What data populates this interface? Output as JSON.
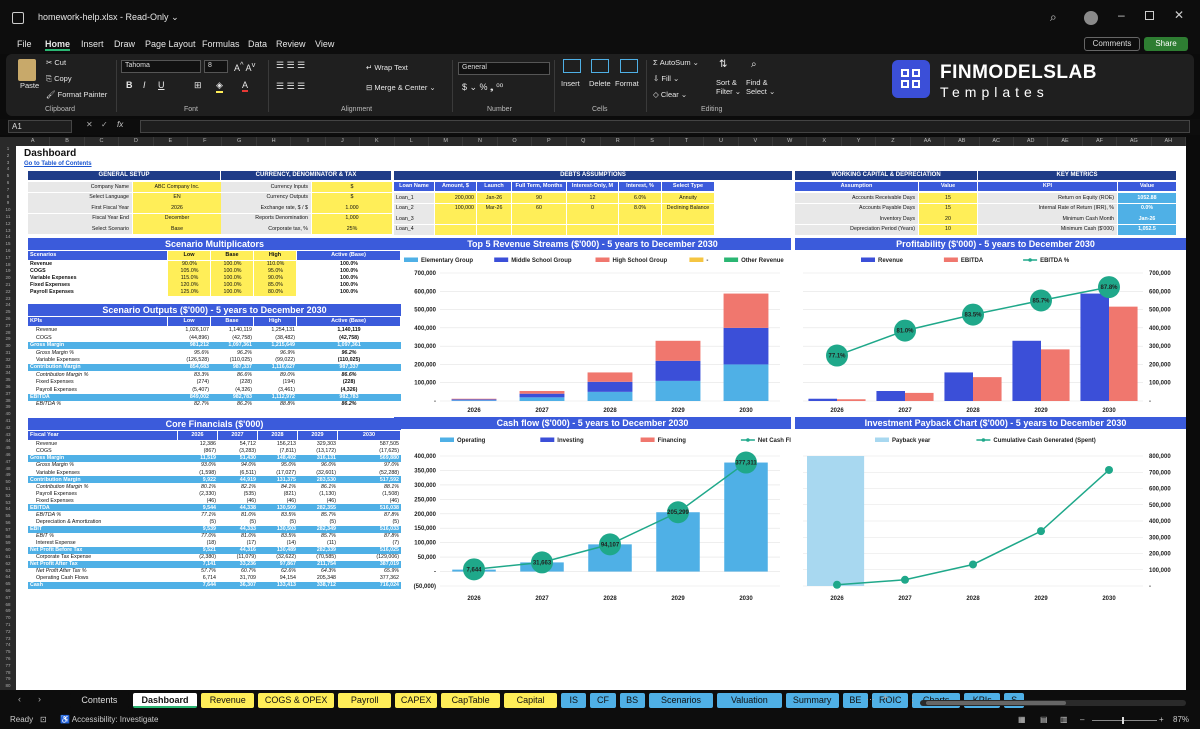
{
  "window": {
    "title": "homework-help.xlsx  -  Read-Only",
    "title_chevron": "⌄"
  },
  "menu": [
    "File",
    "Home",
    "Insert",
    "Draw",
    "Page Layout",
    "Formulas",
    "Data",
    "Review",
    "View"
  ],
  "topright": {
    "comments": "Comments",
    "share": "Share"
  },
  "ribbon": {
    "paste": "Paste",
    "cut": "Cut",
    "copy": "Copy",
    "format_painter": "Format Painter",
    "clipboard": "Clipboard",
    "font_name": "Tahoma",
    "font_size": "8",
    "font": "Font",
    "wrap": "Wrap Text",
    "merge": "Merge & Center",
    "alignment": "Alignment",
    "numfmt": "General",
    "number": "Number",
    "insert": "Insert",
    "delete": "Delete",
    "format": "Format",
    "cells": "Cells",
    "autosum": "AutoSum",
    "fill": "Fill",
    "clear": "Clear",
    "sort": "Sort &",
    "filter": "Filter",
    "find": "Find &",
    "select": "Select",
    "editing": "Editing",
    "brand": "FINMODELSLAB",
    "brand_sub": "Templates"
  },
  "formula": {
    "namebox": "A1",
    "fx": "fx",
    "value": ""
  },
  "columns": [
    "A",
    "B",
    "C",
    "D",
    "E",
    "F",
    "G",
    "H",
    "I",
    "J",
    "K",
    "L",
    "M",
    "N",
    "O",
    "P",
    "Q",
    "R",
    "S",
    "T",
    "U",
    "V",
    "W",
    "X",
    "Y",
    "Z",
    "AA",
    "AB",
    "AC",
    "AD",
    "AE",
    "AF",
    "AG",
    "AH"
  ],
  "rows": [
    "1",
    "2",
    "3",
    "4",
    "5",
    "6",
    "7",
    "8",
    "9",
    "10",
    "11",
    "12",
    "13",
    "14",
    "15",
    "16",
    "17",
    "18",
    "19",
    "20",
    "21",
    "22",
    "23",
    "24",
    "25",
    "26",
    "27",
    "28",
    "29",
    "30",
    "31",
    "32",
    "33",
    "34",
    "35",
    "36",
    "37",
    "38",
    "39",
    "40",
    "41",
    "42",
    "43",
    "44",
    "45",
    "46",
    "47",
    "48",
    "49",
    "50",
    "51",
    "52",
    "53",
    "54",
    "55",
    "56",
    "57",
    "58",
    "59",
    "60",
    "61",
    "62",
    "63",
    "64",
    "65",
    "66",
    "67",
    "68",
    "69",
    "70",
    "71",
    "72",
    "73",
    "74",
    "75",
    "76",
    "77",
    "78",
    "79",
    "80"
  ],
  "sheet": {
    "title": "Dashboard",
    "toc": "Go to Table of Contents",
    "general": {
      "header": "GENERAL SETUP",
      "rows": [
        [
          "Company Name",
          "ABC Company Inc."
        ],
        [
          "Select Language",
          "EN"
        ],
        [
          "First Fiscal Year",
          "2026"
        ],
        [
          "Fiscal Year End",
          "December"
        ],
        [
          "Select Scenario",
          "Base"
        ]
      ]
    },
    "currency": {
      "header": "CURRENCY, DENOMINATOR & TAX",
      "rows": [
        [
          "Currency Inputs",
          "$"
        ],
        [
          "Currency Outputs",
          "$"
        ],
        [
          "Exchange rate, $ / $",
          "1.000"
        ],
        [
          "Reports Denomination",
          "1,000"
        ],
        [
          "Corporate tax, %",
          "25%"
        ]
      ]
    },
    "debts": {
      "header": "DEBTS ASSUMPTIONS",
      "cols": [
        "Loan Name",
        "Amount, $",
        "Launch",
        "Full Term, Months",
        "Interest-Only, M",
        "Interest, %",
        "Select Type"
      ],
      "rows": [
        [
          "Loan_1",
          "200,000",
          "Jan-26",
          "90",
          "12",
          "6.0%",
          "Annuity"
        ],
        [
          "Loan_2",
          "100,000",
          "Mar-26",
          "60",
          "0",
          "8.0%",
          "Declining Balance"
        ],
        [
          "Loan_3",
          "",
          "",
          "",
          "",
          "",
          ""
        ],
        [
          "Loan_4",
          "",
          "",
          "",
          "",
          "",
          ""
        ]
      ]
    },
    "wc": {
      "header": "WORKING CAPITAL & DEPRECIATION",
      "cols": [
        "Assumption",
        "Value"
      ],
      "rows": [
        [
          "Accounts Receivable Days",
          "15"
        ],
        [
          "Accounts Payable Days",
          "15"
        ],
        [
          "Inventory Days",
          "20"
        ],
        [
          "Depreciation Period (Years)",
          "10"
        ]
      ]
    },
    "km": {
      "header": "KEY METRICS",
      "cols": [
        "KPI",
        "Value"
      ],
      "rows": [
        [
          "Return on Equity (ROE)",
          "1052.88"
        ],
        [
          "Internal Rate of Return (IRR), %",
          "0.0%"
        ],
        [
          "Minimum Cash Month",
          "Jan-26"
        ],
        [
          "Minimum Cash ($'000)",
          "1,052.5"
        ]
      ]
    },
    "multipliers": {
      "band": "Scenario Multiplicators",
      "cols": [
        "Scenarios",
        "Low",
        "Base",
        "High",
        "Active (Base)"
      ],
      "rows": [
        [
          "Revenue",
          "90.0%",
          "100.0%",
          "110.0%",
          "100.0%"
        ],
        [
          "COGS",
          "105.0%",
          "100.0%",
          "95.0%",
          "100.0%"
        ],
        [
          "Variable Expenses",
          "115.0%",
          "100.0%",
          "90.0%",
          "100.0%"
        ],
        [
          "Fixed Expenses",
          "120.0%",
          "100.0%",
          "85.0%",
          "100.0%"
        ],
        [
          "Payroll Expenses",
          "125.0%",
          "100.0%",
          "80.0%",
          "100.0%"
        ]
      ]
    },
    "outputs": {
      "band": "Scenario Outputs ($'000) - 5 years to December 2030",
      "cols": [
        "KPIs",
        "Low",
        "Base",
        "High",
        "Active (Base)"
      ],
      "rows": [
        [
          "Revenue",
          "1,026,107",
          "1,140,119",
          "1,254,131",
          "1,140,119",
          "n"
        ],
        [
          "COGS",
          "(44,896)",
          "(42,758)",
          "(38,482)",
          "(42,758)",
          "n"
        ],
        [
          "Gross Margin",
          "981,212",
          "1,097,361",
          "1,215,649",
          "1,097,361",
          "h"
        ],
        [
          "Gross Margin %",
          "95.6%",
          "96.2%",
          "96.9%",
          "96.2%",
          "i"
        ],
        [
          "Variable Expenses",
          "(126,528)",
          "(110,025)",
          "(99,022)",
          "(110,025)",
          "n"
        ],
        [
          "Contribution Margin",
          "854,683",
          "987,337",
          "1,116,627",
          "987,337",
          "h"
        ],
        [
          "Contribution Margin %",
          "83.3%",
          "86.6%",
          "89.0%",
          "86.6%",
          "i"
        ],
        [
          "Fixed Expenses",
          "(274)",
          "(228)",
          "(194)",
          "(228)",
          "n"
        ],
        [
          "Payroll Expenses",
          "(5,407)",
          "(4,326)",
          "(3,461)",
          "(4,326)",
          "n"
        ],
        [
          "EBITDA",
          "849,002",
          "982,783",
          "1,112,972",
          "982,783",
          "h"
        ],
        [
          "EBITDA %",
          "82.7%",
          "86.2%",
          "88.8%",
          "86.2%",
          "i"
        ]
      ]
    },
    "core": {
      "band": "Core Financials ($'000)",
      "cols": [
        "Fiscal Year",
        "2026",
        "2027",
        "2028",
        "2029",
        "2030"
      ],
      "rows": [
        [
          "Revenue",
          "12,386",
          "54,712",
          "156,213",
          "329,303",
          "587,505",
          "n"
        ],
        [
          "COGS",
          "(867)",
          "(3,283)",
          "(7,811)",
          "(13,172)",
          "(17,625)",
          "n"
        ],
        [
          "Gross Margin",
          "11,519",
          "51,430",
          "148,402",
          "316,131",
          "569,880",
          "h"
        ],
        [
          "Gross Margin %",
          "93.0%",
          "94.0%",
          "95.0%",
          "96.0%",
          "97.0%",
          "i"
        ],
        [
          "Variable Expenses",
          "(1,598)",
          "(6,511)",
          "(17,027)",
          "(32,601)",
          "(52,288)",
          "n"
        ],
        [
          "Contribution Margin",
          "9,922",
          "44,919",
          "131,375",
          "283,530",
          "517,592",
          "h"
        ],
        [
          "Contribution Margin %",
          "80.1%",
          "82.1%",
          "84.1%",
          "86.1%",
          "88.1%",
          "i"
        ],
        [
          "Payroll Expenses",
          "(2,330)",
          "(535)",
          "(821)",
          "(1,130)",
          "(1,508)",
          "n"
        ],
        [
          "Fixed Expenses",
          "(46)",
          "(46)",
          "(46)",
          "(46)",
          "(46)",
          "n"
        ],
        [
          "EBITDA",
          "9,544",
          "44,338",
          "130,509",
          "282,355",
          "516,038",
          "h"
        ],
        [
          "EBITDA %",
          "77.1%",
          "81.0%",
          "83.5%",
          "85.7%",
          "87.8%",
          "i"
        ],
        [
          "Depreciation & Amortization",
          "(5)",
          "(5)",
          "(5)",
          "(5)",
          "(5)",
          "n"
        ],
        [
          "EBIT",
          "9,539",
          "44,333",
          "130,503",
          "282,349",
          "516,033",
          "h"
        ],
        [
          "EBIT %",
          "77.0%",
          "81.0%",
          "83.5%",
          "85.7%",
          "87.8%",
          "i"
        ],
        [
          "Interest Expense",
          "(18)",
          "(17)",
          "(14)",
          "(11)",
          "(7)",
          "n"
        ],
        [
          "Net Profit Before Tax",
          "9,521",
          "44,316",
          "130,489",
          "282,339",
          "516,025",
          "h"
        ],
        [
          "Corporate Tax Expense",
          "(2,380)",
          "(11,079)",
          "(32,622)",
          "(70,585)",
          "(129,006)",
          "n"
        ],
        [
          "Net Profit After Tax",
          "7,141",
          "33,236",
          "97,867",
          "211,754",
          "387,019",
          "h"
        ],
        [
          "Net Profit After Tax %",
          "57.7%",
          "60.7%",
          "62.6%",
          "64.3%",
          "65.9%",
          "i"
        ],
        [
          "Operating Cash Flows",
          "6,714",
          "31,709",
          "94,154",
          "205,348",
          "377,362",
          "n"
        ],
        [
          "Cash",
          "7,644",
          "36,307",
          "133,413",
          "338,712",
          "716,024",
          "h"
        ]
      ]
    }
  },
  "charts": {
    "revenue": {
      "title": "Top 5 Revenue Streams ($'000) - 5 years to December 2030",
      "legend": [
        "Elementary Group",
        "Middle School Group",
        "High School Group",
        "-",
        "Other Revenue"
      ],
      "colors": [
        "#4fb0e6",
        "#3b4fd8",
        "#f0776e",
        "#f5c542",
        "#2bb673"
      ],
      "categories": [
        "2026",
        "2027",
        "2028",
        "2029",
        "2030"
      ],
      "yticks": [
        "700,000",
        "600,000",
        "500,000",
        "400,000",
        "300,000",
        "200,000",
        "100,000",
        "-"
      ],
      "ymax": 700000,
      "series": [
        [
          4000,
          20000,
          50000,
          110000,
          200000
        ],
        [
          5000,
          20000,
          55000,
          110000,
          200000
        ],
        [
          3400,
          14712,
          51213,
          109303,
          187505
        ]
      ]
    },
    "profit": {
      "title": "Profitability ($'000) - 5 years to December 2030",
      "legend": [
        "Revenue",
        "EBITDA",
        "EBITDA %"
      ],
      "colors": [
        "#3b4fd8",
        "#f0776e",
        "#1fa88a"
      ],
      "categories": [
        "2026",
        "2027",
        "2028",
        "2029",
        "2030"
      ],
      "yticks": [
        "700,000",
        "600,000",
        "500,000",
        "400,000",
        "300,000",
        "200,000",
        "100,000",
        "-"
      ],
      "ymax": 700000,
      "revenue": [
        12386,
        54712,
        156213,
        329303,
        587505
      ],
      "ebitda": [
        9544,
        44338,
        130509,
        282355,
        516038
      ],
      "pct": [
        77.1,
        81.0,
        83.5,
        85.7,
        87.8
      ],
      "pct_labels": [
        "77.1%",
        "81.0%",
        "83.5%",
        "85.7%",
        "87.8%"
      ]
    },
    "cash": {
      "title": "Cash flow ($'000) - 5 years to December 2030",
      "legend": [
        "Operating",
        "Investing",
        "Financing",
        "Net Cash Flow"
      ],
      "colors": [
        "#4fb0e6",
        "#3b4fd8",
        "#f0776e",
        "#1fa88a"
      ],
      "categories": [
        "2026",
        "2027",
        "2028",
        "2029",
        "2030"
      ],
      "yticks": [
        "400,000",
        "350,000",
        "300,000",
        "250,000",
        "200,000",
        "150,000",
        "100,000",
        "50,000",
        "-",
        "(50,000)"
      ],
      "ymin": -50000,
      "ymax": 400000,
      "operating": [
        6714,
        31709,
        94154,
        205348,
        377362
      ],
      "net": [
        7644,
        31663,
        94107,
        205299,
        377311
      ],
      "net_labels": [
        "7,644",
        "31,663",
        "94,107",
        "205,299",
        "377,311"
      ]
    },
    "payback": {
      "title": "Investment Payback Chart ($'000) - 5 years to December 2030",
      "legend": [
        "Payback year",
        "Cumulative Cash Generated (Spent)"
      ],
      "colors": [
        "#a8d8f0",
        "#1fa88a"
      ],
      "categories": [
        "2026",
        "2027",
        "2028",
        "2029",
        "2030"
      ],
      "yticks": [
        "800,000",
        "700,000",
        "600,000",
        "500,000",
        "400,000",
        "300,000",
        "200,000",
        "100,000",
        "-"
      ],
      "ymax": 800000,
      "values": [
        7644,
        38307,
        132414,
        337713,
        714024
      ]
    }
  },
  "tabs": [
    [
      "Contents",
      "#0d0d0d",
      "#ddd"
    ],
    [
      "Dashboard",
      "#fff",
      "#111"
    ],
    [
      "Revenue",
      "#ffee58",
      "#111"
    ],
    [
      "COGS & OPEX",
      "#ffee58",
      "#111"
    ],
    [
      "Payroll",
      "#ffee58",
      "#111"
    ],
    [
      "CAPEX",
      "#ffee58",
      "#111"
    ],
    [
      "CapTable",
      "#ffee58",
      "#111"
    ],
    [
      "Capital",
      "#ffee58",
      "#111"
    ],
    [
      "IS",
      "#4fb0e6",
      "#111"
    ],
    [
      "CF",
      "#4fb0e6",
      "#111"
    ],
    [
      "BS",
      "#4fb0e6",
      "#111"
    ],
    [
      "Scenarios",
      "#4fb0e6",
      "#111"
    ],
    [
      "Valuation",
      "#4fb0e6",
      "#111"
    ],
    [
      "Summary",
      "#4fb0e6",
      "#111"
    ],
    [
      "BE",
      "#4fb0e6",
      "#111"
    ],
    [
      "ROIC",
      "#4fb0e6",
      "#111"
    ],
    [
      "Charts",
      "#4fb0e6",
      "#111"
    ],
    [
      "KPIs",
      "#4fb0e6",
      "#111"
    ],
    [
      "S",
      "#4fb0e6",
      "#111"
    ]
  ],
  "status": {
    "ready": "Ready",
    "accessibility": "Accessibility: Investigate",
    "zoom": "87%"
  }
}
